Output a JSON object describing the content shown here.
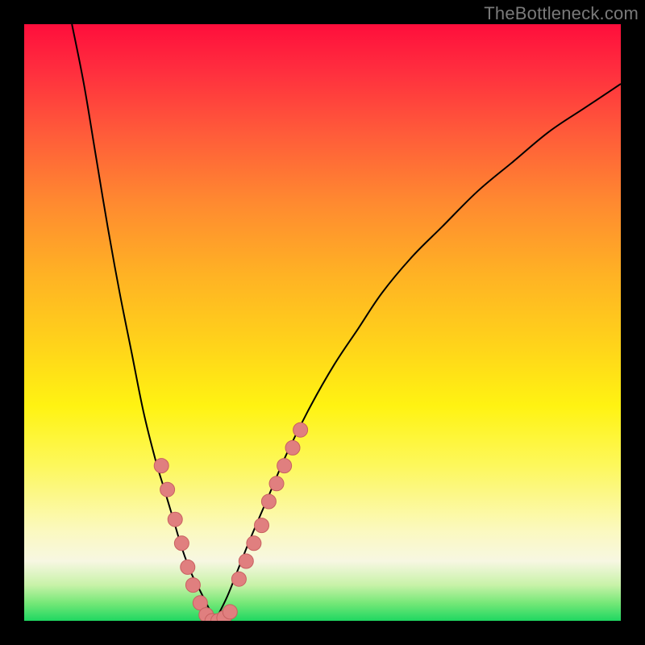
{
  "watermark": {
    "text": "TheBottleneck.com"
  },
  "colors": {
    "curve": "#000000",
    "dot_fill": "#e07f7f",
    "dot_stroke": "#c86060",
    "background": "#000000"
  },
  "chart_data": {
    "type": "line",
    "title": "",
    "xlabel": "",
    "ylabel": "",
    "xlim": [
      0,
      100
    ],
    "ylim": [
      0,
      100
    ],
    "grid": false,
    "legend": false,
    "series": [
      {
        "name": "left-curve",
        "x": [
          8,
          10,
          12,
          14,
          16,
          18,
          20,
          22,
          23.5,
          25,
          26.5,
          28,
          29.5,
          31,
          32
        ],
        "y": [
          100,
          90,
          78,
          66,
          55,
          45,
          35,
          27,
          22,
          17,
          12,
          8,
          5,
          2,
          0
        ]
      },
      {
        "name": "right-curve",
        "x": [
          32,
          34,
          36,
          38,
          41,
          44,
          48,
          52,
          56,
          60,
          65,
          70,
          76,
          82,
          88,
          94,
          100
        ],
        "y": [
          0,
          4,
          9,
          14,
          21,
          28,
          36,
          43,
          49,
          55,
          61,
          66,
          72,
          77,
          82,
          86,
          90
        ]
      }
    ],
    "annotations": {
      "dots_left": {
        "x": [
          23,
          24,
          25.3,
          26.4,
          27.4,
          28.3,
          29.5
        ],
        "y": [
          26,
          22,
          17,
          13,
          9,
          6,
          3
        ]
      },
      "dots_bottom": {
        "x": [
          30.5,
          31.5,
          32.5,
          33.5,
          34.5
        ],
        "y": [
          1,
          0,
          0,
          0.5,
          1.5
        ]
      },
      "dots_right": {
        "x": [
          36,
          37.2,
          38.5,
          39.8,
          41,
          42.3,
          43.6,
          45,
          46.3
        ],
        "y": [
          7,
          10,
          13,
          16,
          20,
          23,
          26,
          29,
          32
        ]
      }
    }
  }
}
